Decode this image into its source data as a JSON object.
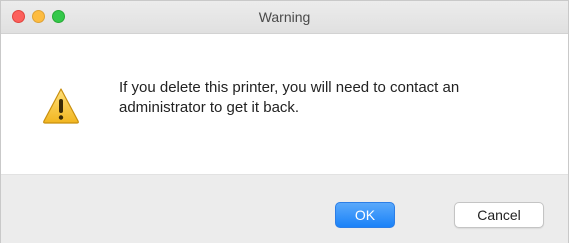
{
  "window": {
    "title": "Warning"
  },
  "dialog": {
    "icon": "warning-triangle-icon",
    "message": "If you delete this printer, you will need to contact an administrator to get it back.",
    "ok_label": "OK",
    "cancel_label": "Cancel"
  },
  "colors": {
    "ok_button": "#1a82f8",
    "traffic_close": "#fc605c",
    "traffic_minimize": "#fdbc40",
    "traffic_zoom": "#34c84a",
    "footer_background": "#ececec"
  }
}
